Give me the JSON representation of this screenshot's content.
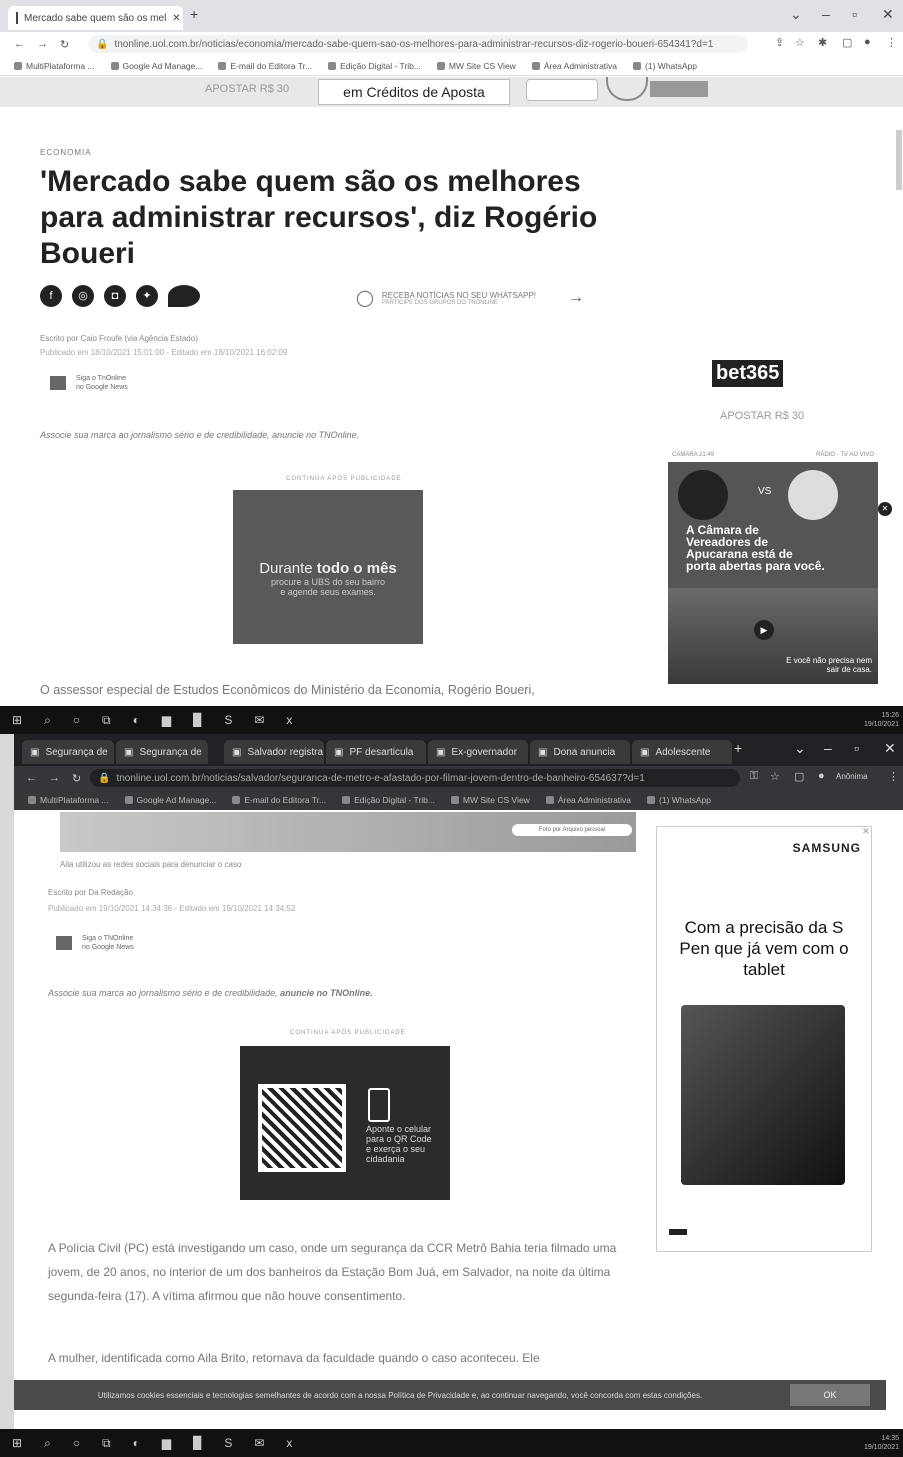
{
  "window1": {
    "tab_title": "Mercado sabe quem são os mel",
    "url": "tnonline.uol.com.br/noticias/economia/mercado-sabe-quem-sao-os-melhores-para-administrar-recursos-diz-rogerio-boueri-654341?d=1",
    "bookmarks": [
      "MultiPlataforma ...",
      "Google Ad Manage...",
      "E-mail do Editora Tr...",
      "Edição Digital - Trib...",
      "MW Site CS View",
      "Área Administrativa",
      "(1) WhatsApp"
    ],
    "top_banner": {
      "left_text": "APOSTAR R$ 30",
      "center_text": "em Créditos de Aposta"
    },
    "category": "ECONOMIA",
    "headline": "'Mercado sabe quem são os melhores para administrar recursos', diz Rogério Boueri",
    "whatsapp_cta": {
      "line1": "RECEBA NOTÍCIAS NO SEU WHATSAPP!",
      "line2": "PARTICIPE DOS GRUPOS DO TNONLINE"
    },
    "byline": "Escrito por Caio Froufe (via Agência Estado)",
    "dates": "Publicado em 18/10/2021 15:01:00 - Editado em 18/10/2021 16:02:09",
    "google_news": {
      "line1": "Siga o TnOnline",
      "line2": "no Google News"
    },
    "associate": "Associe sua marca ao jornalismo sério e de credibilidade, anuncie no TNOnline.",
    "ad_label": "CONTINUA APÓS PUBLICIDADE",
    "ad_text": {
      "line1a": "Durante ",
      "line1b": "todo o mês",
      "line2": "procure a UBS do seu bairro",
      "line3": "e agende seus exames."
    },
    "sidebar": {
      "brand": "bet365",
      "sub": "APOSTAR R$ 30",
      "header_left": "CAMARA 21:49",
      "header_right": "RÁDIO  ·  TV AO VIVO",
      "vs": "VS",
      "promo_text": "A Câmara de Vereadores de Apucarana está de porta abertas para você.",
      "promo_tag": "E você não precisa nem sair de casa."
    },
    "paragraph": "O assessor especial de Estudos Econômicos do Ministério da Economia, Rogério Boueri,",
    "clock": {
      "time": "15:26",
      "date": "19/10/2021"
    }
  },
  "window2": {
    "tabs": [
      "Segurança de",
      "Segurança de",
      "Salvador registra",
      "PF desarticula",
      "Ex-governador",
      "Dona anuncia",
      "Adolescente"
    ],
    "url": "tnonline.uol.com.br/noticias/salvador/seguranca-de-metro-e-afastado-por-filmar-jovem-dentro-de-banheiro-654637?d=1",
    "profile": "Anônima",
    "bookmarks": [
      "MultiPlataforma ...",
      "Google Ad Manage...",
      "E-mail do Editora Tr...",
      "Edição Digital - Trib...",
      "MW Site CS View",
      "Área Administrativa",
      "(1) WhatsApp"
    ],
    "photo_credit": "Foto por Arquivo pessoal",
    "caption": "Aila utilizou as redes sociais para denunciar o caso",
    "byline": "Escrito por Da Redação",
    "dates": "Publicado em 19/10/2021 14:34:36 - Editado em 19/10/2021 14:34:52",
    "google_news": {
      "line1": "Siga o TNOnline",
      "line2": "no Google News"
    },
    "associate_a": "Associe sua marca ao jornalismo sério e de credibilidade, ",
    "associate_b": "anuncie no TNOnline.",
    "ad_label": "CONTINUA APÓS PUBLICIDADE",
    "qr_text": "Aponte o celular para o QR Code e exerça o seu cidadania",
    "p1": "A Polícia Civil (PC) está investigando um caso, onde um segurança da CCR Metrô Bahia teria filmado uma jovem, de 20 anos, no interior de um dos banheiros da Estação Bom Juá, em Salvador, na noite da última segunda-feira (17). A vítima afirmou que não houve consentimento.",
    "p2": "A mulher, identificada como Aila Brito, retornava da faculdade quando o caso aconteceu. Ele",
    "samsung": {
      "brand": "SAMSUNG",
      "headline": "Com a precisão da S Pen que já vem com o tablet"
    },
    "cookie": {
      "text": "Utilizamos cookies essenciais e tecnologias semelhantes de acordo com a nossa Política de Privacidade e, ao continuar navegando, você concorda com estas condições.",
      "ok": "OK"
    },
    "clock": {
      "time": "14:35",
      "date": "19/10/2021"
    }
  }
}
